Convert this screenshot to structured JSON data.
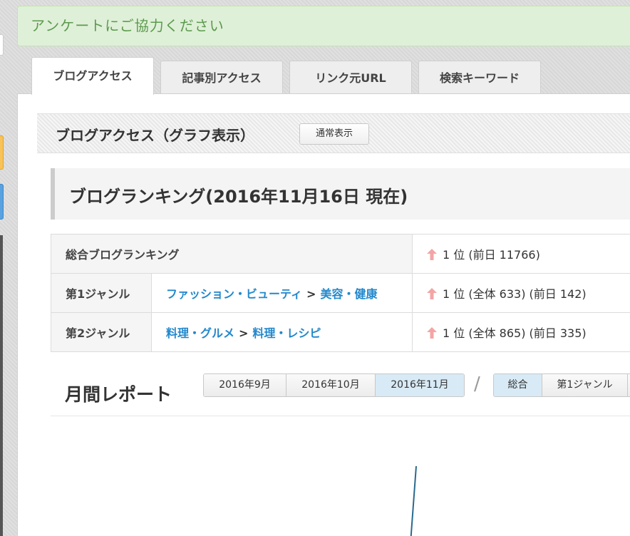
{
  "notice": {
    "text": "アンケートにご協力ください"
  },
  "tabs": [
    {
      "label": "ブログアクセス",
      "active": true
    },
    {
      "label": "記事別アクセス",
      "active": false
    },
    {
      "label": "リンク元URL",
      "active": false
    },
    {
      "label": "検索キーワード",
      "active": false
    }
  ],
  "section": {
    "title": "ブログアクセス（グラフ表示）",
    "normal_view_label": "通常表示"
  },
  "ranking": {
    "title": "ブログランキング(2016年11月16日 現在)",
    "rows": [
      {
        "label": "総合ブログランキング",
        "rank": "1 位 (前日 11766)"
      },
      {
        "label": "第1ジャンル",
        "genre": "ファッション・ビューティ",
        "subgenre": "美容・健康",
        "rank": "1 位 (全体 633) (前日 142)"
      },
      {
        "label": "第2ジャンル",
        "genre": "料理・グルメ",
        "subgenre": "料理・レシピ",
        "rank": "1 位 (全体 865) (前日 335)"
      }
    ],
    "separator": ">",
    "arrow_color": "#f4a4a4",
    "link_color": "#2288cc"
  },
  "monthly": {
    "title": "月間レポート",
    "months": [
      "2016年9月",
      "2016年10月",
      "2016年11月"
    ],
    "active_month": "2016年11月",
    "slash": "/",
    "types": [
      "総合",
      "第1ジャンル"
    ],
    "active_type": "総合"
  },
  "colors": {
    "notice_bg": "#dff0d8",
    "notice_text": "#5c9a4e",
    "active_segment": "#d8eaf5",
    "chart_line": "#2a6a8e"
  }
}
